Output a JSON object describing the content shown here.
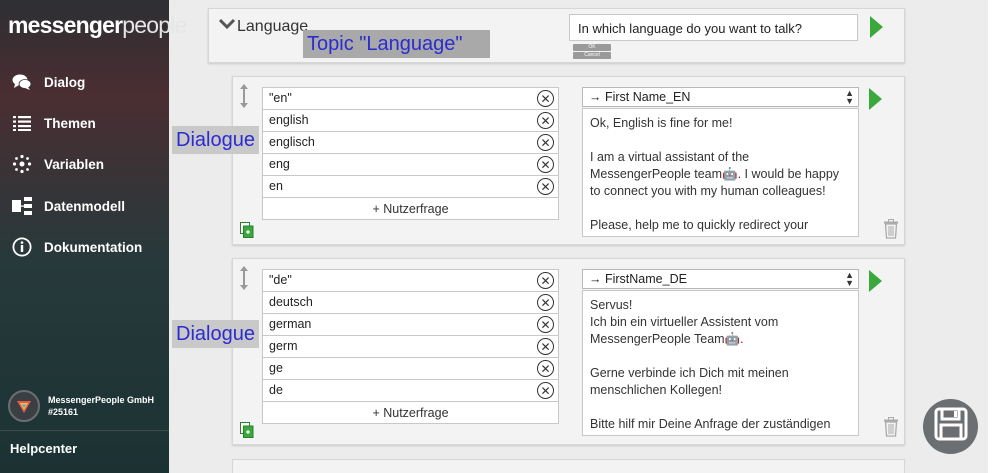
{
  "sidebar": {
    "logo_bold": "messenger",
    "logo_light": "people",
    "items": [
      {
        "label": "Dialog",
        "icon": "chat-bubbles-icon"
      },
      {
        "label": "Themen",
        "icon": "list-icon"
      },
      {
        "label": "Variablen",
        "icon": "variables-icon"
      },
      {
        "label": "Datenmodell",
        "icon": "data-model-icon"
      },
      {
        "label": "Dokumentation",
        "icon": "info-icon"
      }
    ],
    "account_name": "MessengerPeople GmbH",
    "account_id": "#25161",
    "helpcenter": "Helpcenter"
  },
  "topic": {
    "title": "Language",
    "annotation": "Topic \"Language\"",
    "question": "In which language do you want to talk?",
    "ok_label": "OK",
    "cancel_label": "Cancel"
  },
  "dialogues": [
    {
      "annotation": "Dialogue",
      "utterances": [
        "\"en\"",
        "english",
        "englisch",
        "eng",
        "en"
      ],
      "add_label": "+ Nutzerfrage",
      "variable": "→ First Name_EN",
      "answer": "Ok, English is fine for me!\n\nI am a virtual assistant of the MessengerPeople team🤖. I would be happy to connect you with my human colleagues!\n\nPlease, help me to quickly redirect your request"
    },
    {
      "annotation": "Dialogue",
      "utterances": [
        "\"de\"",
        "deutsch",
        "german",
        "germ",
        "ge",
        "de"
      ],
      "add_label": "+ Nutzerfrage",
      "variable": "→ FirstName_DE",
      "answer": "Servus!\nIch bin ein virtueller Assistent vom MessengerPeople Team🤖.\n\nGerne verbinde ich Dich mit meinen menschlichen Kollegen!\n\nBitte hilf mir Deine Anfrage der zuständigen"
    }
  ],
  "colors": {
    "accent_green": "#3aa83a",
    "annotation_text": "#2b2bd1"
  }
}
